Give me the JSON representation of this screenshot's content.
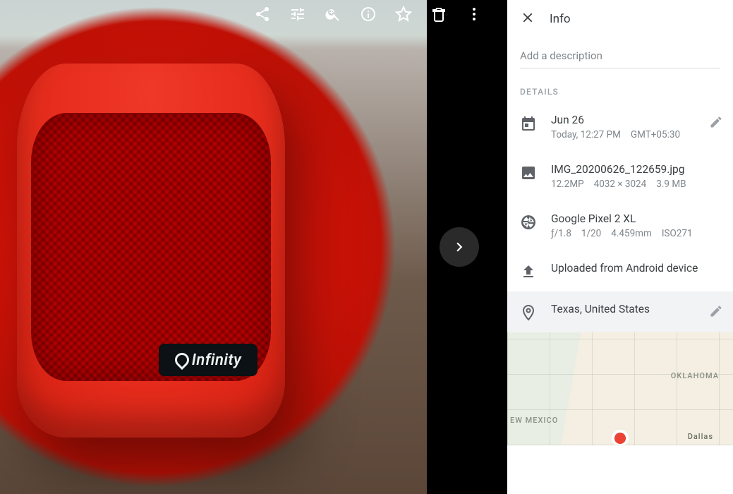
{
  "panel": {
    "title": "Info",
    "description_placeholder": "Add a description",
    "details_label": "DETAILS"
  },
  "photo": {
    "brand_text": "Infinity"
  },
  "date": {
    "line1": "Jun 26",
    "today": "Today, 12:27 PM",
    "tz": "GMT+05:30"
  },
  "file": {
    "name": "IMG_20200626_122659.jpg",
    "mp": "12.2MP",
    "dims": "4032 × 3024",
    "size": "3.9 MB"
  },
  "camera": {
    "name": "Google Pixel 2 XL",
    "aperture": "ƒ/1.8",
    "shutter": "1/20",
    "focal": "4.459mm",
    "iso": "ISO271"
  },
  "upload": {
    "text": "Uploaded from Android device"
  },
  "location": {
    "text": "Texas, United States",
    "labels": {
      "ok": "OKLAHOMA",
      "nm": "EW MEXICO",
      "dl": "Dallas"
    }
  }
}
